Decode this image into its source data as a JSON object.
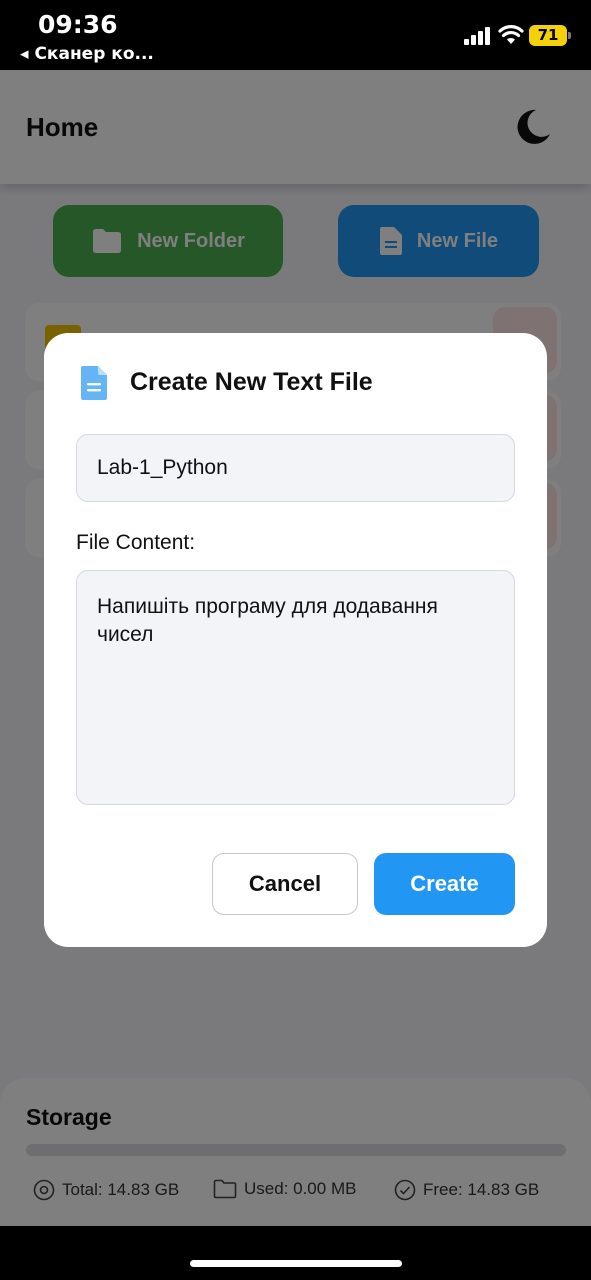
{
  "status_bar": {
    "time": "09:36",
    "back_app": "◂ Сканер ко...",
    "battery": "71"
  },
  "header": {
    "title": "Home"
  },
  "actions": {
    "new_folder": "New Folder",
    "new_file": "New File"
  },
  "modal": {
    "title": "Create New Text File",
    "file_name_value": "Lab-1_Python",
    "content_label": "File Content:",
    "content_value": "Напишіть програму для додавання чисел",
    "cancel_label": "Cancel",
    "create_label": "Create"
  },
  "storage": {
    "title": "Storage",
    "total": "Total: 14.83 GB",
    "used": "Used: 0.00 MB",
    "free": "Free: 14.83 GB"
  },
  "colors": {
    "new_folder_bg": "#4caf50",
    "new_file_bg": "#2196f3",
    "create_bg": "#2196f3",
    "battery": "#f5d10a"
  }
}
